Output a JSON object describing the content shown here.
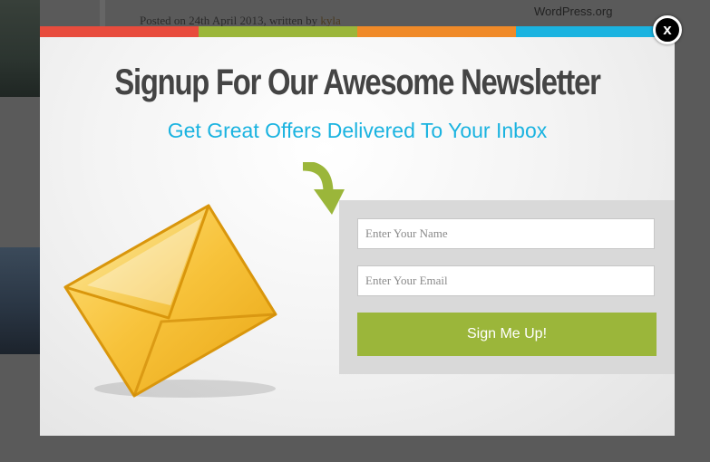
{
  "background": {
    "post_meta_prefix": "Posted on 24th April 2013, written by ",
    "post_meta_author": "kyla",
    "sidebar_link": "WordPress.org"
  },
  "popup": {
    "title": "Signup For Our Awesome Newsletter",
    "subtitle": "Get Great Offers Delivered To Your Inbox",
    "color_bar": [
      "#e84c3d",
      "#9bb63a",
      "#f08a28",
      "#1ab3e0"
    ],
    "name_placeholder": "Enter Your Name",
    "email_placeholder": "Enter Your Email",
    "submit_label": "Sign Me Up!",
    "close_label": "x",
    "colors": {
      "title": "#444444",
      "subtitle": "#1ab3e0",
      "button": "#9bb63a",
      "panel": "#d9d9d9"
    },
    "icons": [
      "curved-arrow-icon",
      "envelope-icon",
      "close-icon"
    ]
  }
}
